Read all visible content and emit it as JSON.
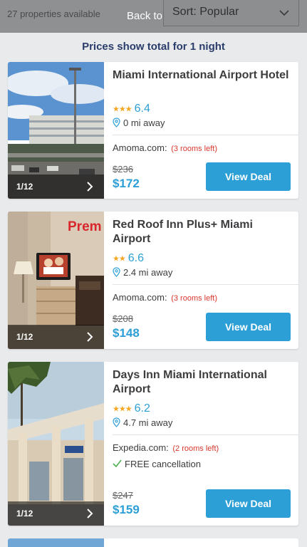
{
  "header": {
    "properties_count": "27 properties available",
    "back_to_top": "Back to top",
    "sort_label": "Sort: Popular"
  },
  "price_note": "Prices show total for 1 night",
  "hotels": [
    {
      "name": "Miami International Airport Hotel",
      "stars": "★★★",
      "score": "6.4",
      "distance": "0 mi away",
      "vendor": "Amoma.com:",
      "rooms_left": "(3 rooms left)",
      "old_price": "$236",
      "price": "$172",
      "photo_page": "1/12",
      "deal_label": "View Deal"
    },
    {
      "name": "Red Roof Inn Plus+ Miami Airport",
      "stars": "★★",
      "score": "6.6",
      "distance": "2.4 mi away",
      "vendor": "Amoma.com:",
      "rooms_left": "(3 rooms left)",
      "old_price": "$208",
      "price": "$148",
      "photo_page": "1/12",
      "deal_label": "View Deal",
      "photo_text": "Prem"
    },
    {
      "name": "Days Inn Miami International Airport",
      "stars": "★★★",
      "score": "6.2",
      "distance": "4.7 mi away",
      "vendor": "Expedia.com:",
      "rooms_left": "(2 rooms left)",
      "cancellation": "FREE cancellation",
      "old_price": "$247",
      "price": "$159",
      "photo_page": "1/12",
      "deal_label": "View Deal"
    }
  ],
  "colors": {
    "accent": "#2b9fd6",
    "stars": "#f5a623",
    "rooms_left": "#d9372c",
    "price_note": "#2a3d6b",
    "free_cancel_check": "#4caf50"
  }
}
